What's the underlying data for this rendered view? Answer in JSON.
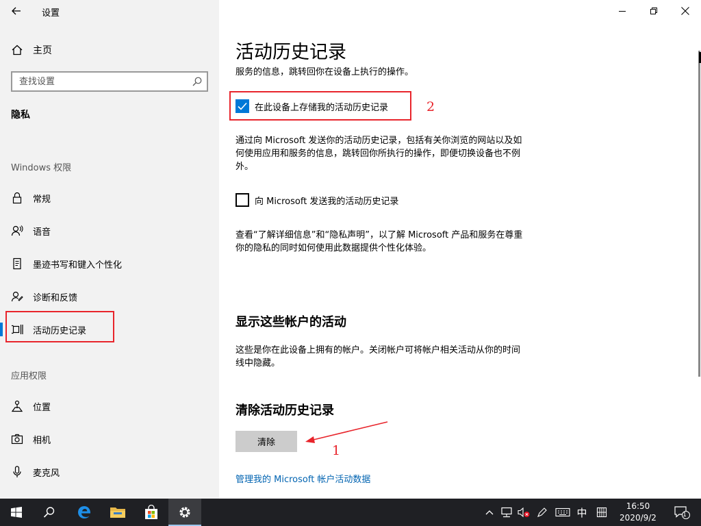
{
  "app": {
    "title": "设置"
  },
  "sidebar": {
    "home_label": "主页",
    "search_placeholder": "查找设置",
    "current_section": "隐私",
    "windows_permissions_header": "Windows 权限",
    "app_permissions_header": "应用权限",
    "items": [
      {
        "label": "常规",
        "icon": "lock-icon"
      },
      {
        "label": "语音",
        "icon": "voice-icon"
      },
      {
        "label": "墨迹书写和键入个性化",
        "icon": "ink-typing-icon"
      },
      {
        "label": "诊断和反馈",
        "icon": "feedback-icon"
      },
      {
        "label": "活动历史记录",
        "icon": "activity-history-icon",
        "selected": true
      },
      {
        "label": "位置",
        "icon": "location-icon"
      },
      {
        "label": "相机",
        "icon": "camera-icon"
      },
      {
        "label": "麦克风",
        "icon": "microphone-icon"
      }
    ]
  },
  "main": {
    "title": "活动历史记录",
    "intro": "服务的信息，跳转回你在设备上执行的操作。",
    "store_history_label": "在此设备上存储我的活动历史记录",
    "store_history_checked": true,
    "send_desc_1": "通过向 Microsoft 发送你的活动历史记录，包括有关你浏览的网站以及如",
    "send_desc_2": "何使用应用和服务的信息，跳转回你所执行的操作，即便切换设备也不例",
    "send_desc_3": "外。",
    "send_history_label": "向 Microsoft 发送我的活动历史记录",
    "send_history_checked": false,
    "privacy_desc_1": "查看“了解详细信息”和“隐私声明”，以了解 Microsoft 产品和服务在尊重",
    "privacy_desc_2": "你的隐私的同时如何使用此数据提供个性化体验。",
    "accounts_heading": "显示这些帐户的活动",
    "accounts_desc_1": "这些是你在此设备上拥有的帐户。关闭帐户可将帐户相关活动从你的时间",
    "accounts_desc_2": "线中隐藏。",
    "clear_heading": "清除活动历史记录",
    "clear_button": "清除",
    "manage_link": "管理我的 Microsoft 帐户活动数据"
  },
  "annotations": {
    "num_1": "1",
    "num_2": "2",
    "color": "#e8242b"
  },
  "taskbar": {
    "ime_label": "中",
    "time": "16:50",
    "date": "2020/9/2",
    "notification_count": "1",
    "accent": "#0078d7"
  }
}
